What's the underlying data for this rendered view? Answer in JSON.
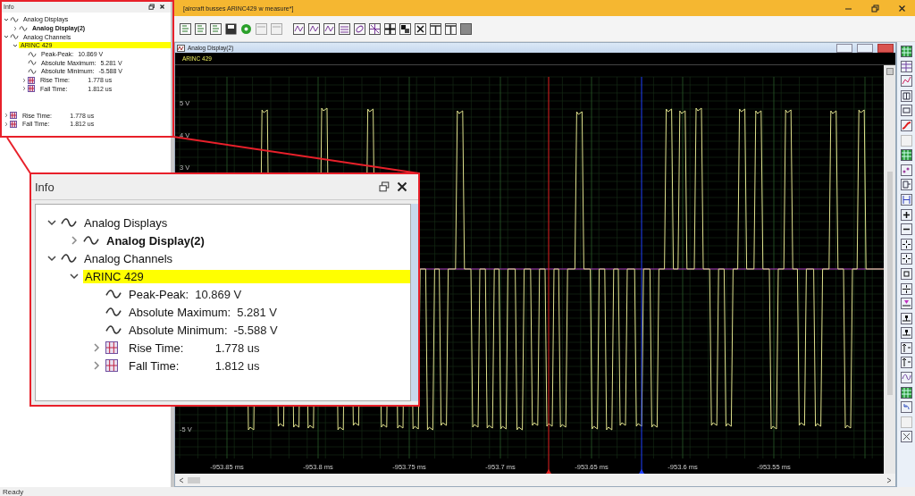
{
  "window": {
    "title": "[aircraft busses ARINC429 w measure*]"
  },
  "info_panel": {
    "title": "Info",
    "tree": [
      {
        "label": "Analog Displays",
        "kind": "wave",
        "expanded": true,
        "selected": false,
        "children": [
          {
            "label": "Analog Display(2)",
            "kind": "wave",
            "expanded": false,
            "selected": false,
            "active": true
          }
        ]
      },
      {
        "label": "Analog Channels",
        "kind": "wave",
        "expanded": true,
        "selected": false,
        "children": [
          {
            "label": "ARINC 429",
            "kind": "channel",
            "expanded": true,
            "selected": true,
            "children": [
              {
                "label": "Peak-Peak:",
                "value": "10.869 V",
                "kind": "wave",
                "selected": false
              },
              {
                "label": "Absolute Maximum:",
                "value": "5.281 V",
                "kind": "wave",
                "selected": false
              },
              {
                "label": "Absolute Minimum:",
                "value": "-5.588 V",
                "kind": "wave",
                "selected": false
              },
              {
                "label": "Rise Time:",
                "value": "1.778 us",
                "kind": "measure",
                "expanded": false,
                "selected": false
              },
              {
                "label": "Fall Time:",
                "value": "1.812 us",
                "kind": "measure",
                "expanded": false,
                "selected": false
              }
            ]
          }
        ]
      }
    ],
    "extra_rows": [
      {
        "label": "Rise Time:",
        "value": "1.778 us",
        "kind": "measure",
        "expanded": false,
        "selected": false
      },
      {
        "label": "Fall Time:",
        "value": "1.812 us",
        "kind": "measure",
        "expanded": false,
        "selected": false
      }
    ]
  },
  "display": {
    "title": "Analog Display(2)",
    "channel": "ARINC 429",
    "y_labels_top": [
      "5 V",
      "4 V",
      "3 V"
    ],
    "y_labels_bottom": [
      "-5 V"
    ],
    "x_labels": [
      "-953.85 ms",
      "-953.8 ms",
      "-953.75 ms",
      "-953.7 ms",
      "-953.65 ms",
      "-953.6 ms",
      "-953.55 ms"
    ]
  },
  "callout": {
    "title": "Info",
    "tree": [
      {
        "label": "Analog Displays",
        "kind": "wave",
        "expanded": true,
        "selected": false,
        "children": [
          {
            "label": "Analog Display(2)",
            "kind": "wave",
            "expanded": false,
            "selected": false,
            "active": true
          }
        ]
      },
      {
        "label": "Analog Channels",
        "kind": "wave",
        "expanded": true,
        "selected": false,
        "children": [
          {
            "label": "ARINC 429",
            "kind": "channel",
            "expanded": true,
            "selected": true,
            "children": [
              {
                "label": "Peak-Peak:",
                "value": "10.869 V",
                "kind": "wave",
                "selected": false
              },
              {
                "label": "Absolute Maximum:",
                "value": "5.281 V",
                "kind": "wave",
                "selected": false
              },
              {
                "label": "Absolute Minimum:",
                "value": "-5.588 V",
                "kind": "wave",
                "selected": false
              },
              {
                "label": "Rise Time:",
                "value": "1.778 us",
                "kind": "measure",
                "expanded": false,
                "selected": false
              },
              {
                "label": "Fall Time:",
                "value": "1.812 us",
                "kind": "measure",
                "expanded": false,
                "selected": false
              }
            ]
          }
        ]
      }
    ]
  },
  "status_bar": {
    "text": "Ready"
  }
}
